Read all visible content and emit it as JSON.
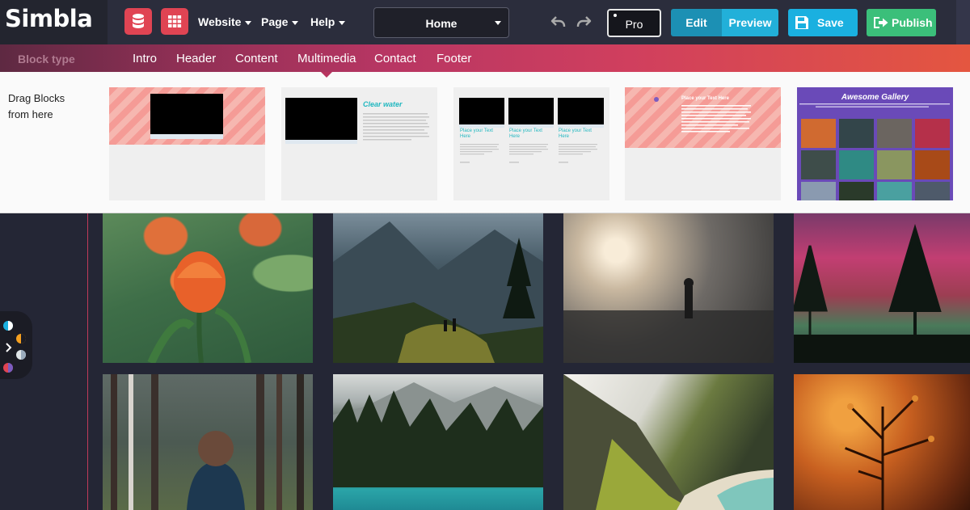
{
  "app": {
    "logo": "Simbla"
  },
  "toolbar": {
    "menus": [
      {
        "label": "Website"
      },
      {
        "label": "Page"
      },
      {
        "label": "Help"
      }
    ],
    "page_select": {
      "value": "Home"
    },
    "pro_label": "Pro",
    "edit_label": "Edit",
    "preview_label": "Preview",
    "save_label": "Save",
    "publish_label": "Publish",
    "colors": {
      "edit": "#1c90b4",
      "preview": "#22b0d9",
      "save": "#1ab0e0",
      "publish": "#3bbf7a",
      "icon_buttons": "#e04453"
    }
  },
  "block_types": {
    "label": "Block type",
    "tabs": [
      {
        "label": "Intro"
      },
      {
        "label": "Header"
      },
      {
        "label": "Content"
      },
      {
        "label": "Multimedia"
      },
      {
        "label": "Contact"
      },
      {
        "label": "Footer"
      }
    ],
    "active": "Multimedia"
  },
  "blocks_panel": {
    "drag_hint_line1": "Drag Blocks",
    "drag_hint_line2": "from here",
    "thumbnails": [
      {
        "kind": "video-striped"
      },
      {
        "kind": "video-with-text",
        "heading": "Clear water"
      },
      {
        "kind": "three-videos",
        "columns": [
          {
            "heading": "Place your Text Here"
          },
          {
            "heading": "Place your Text Here"
          },
          {
            "heading": "Place your Text Here"
          }
        ]
      },
      {
        "kind": "striped-text",
        "heading": "Place your Text Here"
      },
      {
        "kind": "gallery",
        "heading": "Awesome Gallery"
      }
    ]
  },
  "gallery_photos": [
    {
      "subject": "orange tulips"
    },
    {
      "subject": "hikers on mountain ridge"
    },
    {
      "subject": "person in foggy field at sunrise"
    },
    {
      "subject": "pine trees under aurora"
    },
    {
      "subject": "person in forest"
    },
    {
      "subject": "mountain lake with pine forest"
    },
    {
      "subject": "coastal cliff and beach"
    },
    {
      "subject": "dry plants at sunset"
    }
  ]
}
